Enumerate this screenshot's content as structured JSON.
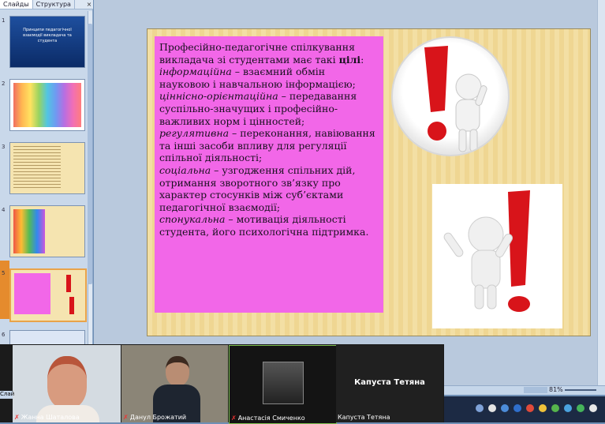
{
  "panel": {
    "tabs": [
      "Слайды",
      "Структура"
    ],
    "close": "×",
    "slides": [
      {
        "num": "1",
        "title": "Принципи педагогічної взаємодії викладача та студента"
      },
      {
        "num": "2"
      },
      {
        "num": "3"
      },
      {
        "num": "4"
      },
      {
        "num": "5"
      },
      {
        "num": "6"
      }
    ]
  },
  "slide": {
    "intro": "Професійно-педагогічне спілкування викладача зі студентами має такі",
    "intro_bold": "цілі",
    "intro_end": ":",
    "items": [
      {
        "term": "інформаційна",
        "text": " – взаємний обмін науковою і навчальною інформацією;"
      },
      {
        "term": "ціннісно-орієнтаційна",
        "text": " – передавання суспільно-значущих і професійно-важливих норм і цінностей;"
      },
      {
        "term": "регулятивна",
        "text": " – переконання, навіювання та інші засоби впливу для регуляції спільної діяльності;"
      },
      {
        "term": "соціальна",
        "text": " – узгодження спільних дій, отримання зворотного зв’язку про характер стосунків між суб’єктами педагогічної взаємодії;"
      },
      {
        "term": "спонукальна",
        "text": " – мотивація діяльності студента, його психологічна підтримка."
      }
    ]
  },
  "video": {
    "participants": [
      {
        "name": "Жанна Шаталова"
      },
      {
        "name": "Данул Брожатий"
      },
      {
        "name": "Анастасія Смиченко"
      },
      {
        "name": "Капуста Тетяна",
        "big_label": "Капуста Тетяна"
      }
    ]
  },
  "status": {
    "zoom": "81%",
    "corner": "Слай"
  },
  "colors": {
    "text_box": "#f267e8",
    "exclamation": "#d8141a",
    "selected": "#e9a34a"
  }
}
